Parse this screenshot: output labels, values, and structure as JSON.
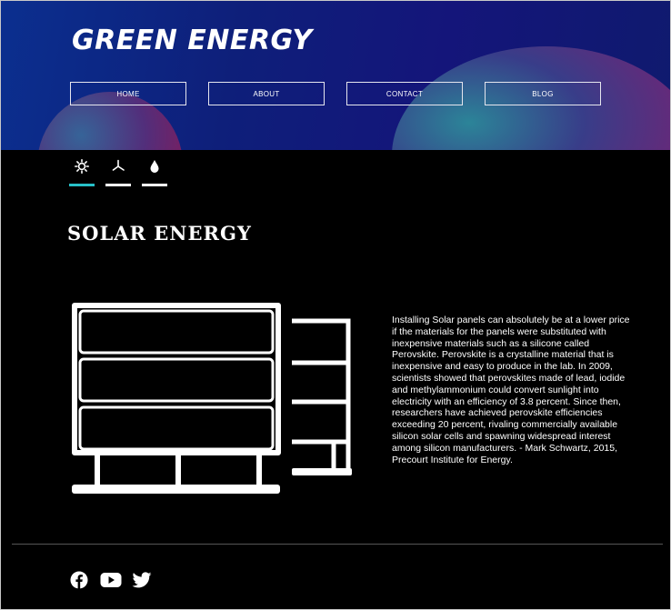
{
  "header": {
    "title": "GREEN ENERGY",
    "nav": [
      {
        "label": "HOME"
      },
      {
        "label": "ABOUT"
      },
      {
        "label": "CONTACT"
      },
      {
        "label": "BLOG"
      }
    ]
  },
  "tabs": [
    {
      "icon": "sun-icon",
      "active": true
    },
    {
      "icon": "wind-turbine-icon",
      "active": false
    },
    {
      "icon": "water-drop-icon",
      "active": false
    }
  ],
  "main": {
    "heading": "SOLAR ENERGY",
    "illustration": "solar-panel-icon",
    "description": "Installing Solar panels can absolutely be at a lower price if the materials for the panels were substituted with inexpensive materials such as a silicone called Perovskite. Perovskite is a crystalline material that is inexpensive and easy to produce in the lab. In 2009, scientists showed that perovskites made of lead, iodide and methylammonium could convert sunlight into electricity with an efficiency of 3.8 percent. Since then, researchers have achieved perovskite efficiencies exceeding 20 percent, rivaling commercially available silicon solar cells and spawning widespread interest among silicon manufacturers. - Mark Schwartz, 2015, Precourt Institute for Energy."
  },
  "footer": {
    "social": [
      "facebook-icon",
      "youtube-icon",
      "twitter-icon"
    ]
  },
  "colors": {
    "accent": "#27c0c8",
    "background": "#000000",
    "header_blue": "#0e1f7a"
  }
}
